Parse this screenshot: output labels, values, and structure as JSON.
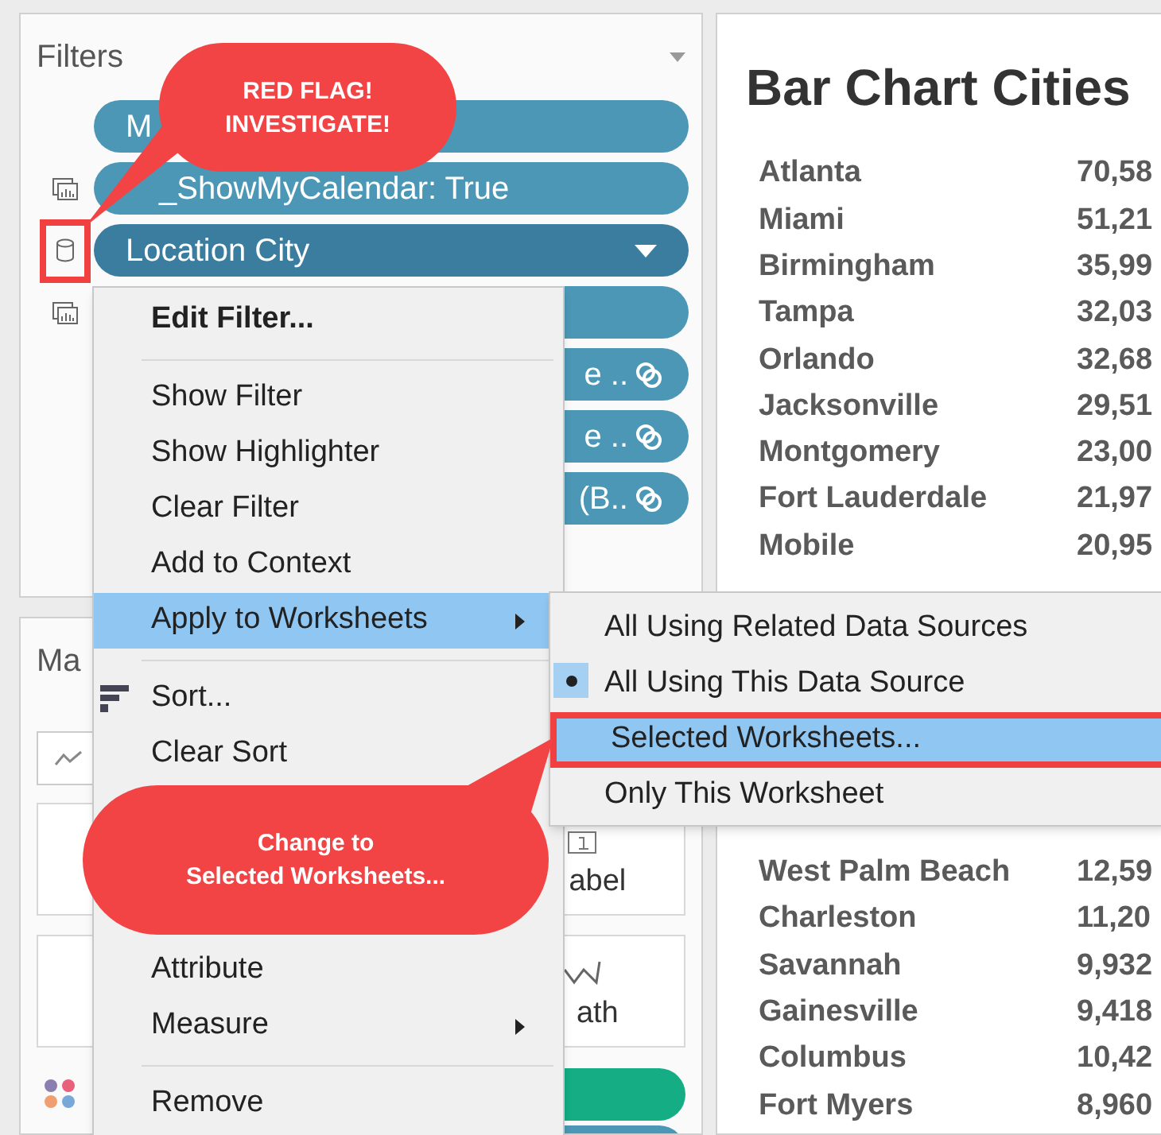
{
  "filters_panel": {
    "title": "Filters",
    "filters": [
      {
        "label": "M",
        "kind": "plain",
        "selected": false,
        "linked": false,
        "flagged": false
      },
      {
        "label": "_ShowMyCalendar: True",
        "kind": "sheets",
        "selected": false,
        "linked": false,
        "flagged": false
      },
      {
        "label": "Location City",
        "kind": "database",
        "selected": true,
        "linked": false,
        "flagged": true
      },
      {
        "kind": "sheets",
        "selected": false,
        "linked": false,
        "flagged": false
      },
      {
        "label": "e ..",
        "kind": "plain",
        "selected": false,
        "linked": true,
        "flagged": false
      },
      {
        "label": "e ..",
        "kind": "plain",
        "selected": false,
        "linked": true,
        "flagged": false
      },
      {
        "label": "(B..",
        "kind": "plain",
        "selected": false,
        "linked": true,
        "flagged": false
      }
    ]
  },
  "marks_panel": {
    "title": "Ma",
    "cards": [
      {
        "label": "abel"
      },
      {
        "label": "ath"
      }
    ],
    "pills": [
      {
        "color": "#14ad84"
      },
      {
        "color": "#4b97b5"
      }
    ]
  },
  "sheet": {
    "title": "Bar Chart Cities",
    "rows": [
      {
        "city": "Atlanta",
        "value": "70,58"
      },
      {
        "city": "Miami",
        "value": "51,21"
      },
      {
        "city": "Birmingham",
        "value": "35,99"
      },
      {
        "city": "Tampa",
        "value": "32,03"
      },
      {
        "city": "Orlando",
        "value": "32,68"
      },
      {
        "city": "Jacksonville",
        "value": "29,51"
      },
      {
        "city": "Montgomery",
        "value": "23,00"
      },
      {
        "city": "Fort Lauderdale",
        "value": "21,97"
      },
      {
        "city": "Mobile",
        "value": "20,95"
      },
      {
        "city": "West Palm Beach",
        "value": "12,59"
      },
      {
        "city": "Charleston",
        "value": "11,20"
      },
      {
        "city": "Savannah",
        "value": "9,932"
      },
      {
        "city": "Gainesville",
        "value": "9,418"
      },
      {
        "city": "Columbus",
        "value": "10,42"
      },
      {
        "city": "Fort Myers",
        "value": "8,960"
      }
    ]
  },
  "context_menu": {
    "items": [
      {
        "kind": "item",
        "label": "Edit Filter...",
        "bold": true,
        "highlighted": false,
        "submenu": false
      },
      {
        "kind": "separator"
      },
      {
        "kind": "item",
        "label": "Show Filter",
        "bold": false,
        "highlighted": false,
        "submenu": false
      },
      {
        "kind": "item",
        "label": "Show Highlighter",
        "bold": false,
        "highlighted": false,
        "submenu": false
      },
      {
        "kind": "item",
        "label": "Clear Filter",
        "bold": false,
        "highlighted": false,
        "submenu": false
      },
      {
        "kind": "item",
        "label": "Add to Context",
        "bold": false,
        "highlighted": false,
        "submenu": false
      },
      {
        "kind": "item",
        "label": "Apply to Worksheets",
        "bold": false,
        "highlighted": true,
        "submenu": true
      },
      {
        "kind": "separator"
      },
      {
        "kind": "sort",
        "label": "Sort...",
        "bold": false,
        "highlighted": false,
        "submenu": false
      },
      {
        "kind": "item",
        "label": "Clear Sort",
        "bold": false,
        "highlighted": false,
        "submenu": false
      },
      {
        "kind": "item",
        "label": "Attribute",
        "bold": false,
        "highlighted": false,
        "submenu": false
      },
      {
        "kind": "item",
        "label": "Measure",
        "bold": false,
        "highlighted": false,
        "submenu": true
      },
      {
        "kind": "separator"
      },
      {
        "kind": "item",
        "label": "Remove",
        "bold": false,
        "highlighted": false,
        "submenu": false
      }
    ]
  },
  "submenu": {
    "items": [
      {
        "label": "All Using Related Data Sources",
        "selected": false,
        "highlighted": false,
        "flagged": false
      },
      {
        "label": "All Using This Data Source",
        "selected": true,
        "highlighted": false,
        "flagged": false
      },
      {
        "label": "Selected Worksheets...",
        "selected": false,
        "highlighted": true,
        "flagged": true
      },
      {
        "label": "Only This Worksheet",
        "selected": false,
        "highlighted": false,
        "flagged": false
      }
    ]
  },
  "callouts": [
    {
      "kind": "top",
      "lines": [
        "RED FLAG!",
        "INVESTIGATE!"
      ]
    },
    {
      "kind": "bottom",
      "lines": [
        "Change to",
        "Selected Worksheets..."
      ]
    }
  ]
}
